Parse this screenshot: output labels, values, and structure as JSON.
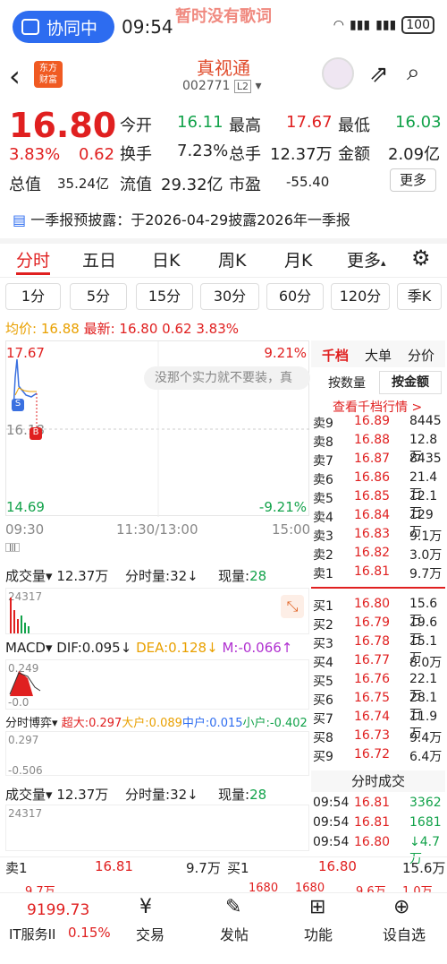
{
  "status": {
    "collab": "协同中",
    "time": "09:54",
    "lyric": "暂时没有歌词",
    "battery": "100"
  },
  "header": {
    "name": "真视通",
    "code": "002771",
    "level": "L2",
    "logo": "东方\n财富"
  },
  "quote": {
    "price": "16.80",
    "pct": "3.83%",
    "chg": "0.62",
    "open_l": "今开",
    "open": "16.11",
    "high_l": "最高",
    "high": "17.67",
    "low_l": "最低",
    "low": "16.03",
    "turn_l": "换手",
    "turn": "7.23%",
    "vol_l": "总手",
    "vol": "12.37万",
    "amt_l": "金额",
    "amt": "2.09亿",
    "mcap_l": "总值",
    "mcap": "35.24亿",
    "float_l": "流值",
    "float": "29.32亿",
    "pe_l": "市盈",
    "pe": "-55.40",
    "more": "更多"
  },
  "announcement": "一季报预披露：于2026-04-29披露2026年一季报",
  "tabs": [
    "分时",
    "五日",
    "日K",
    "周K",
    "月K",
    "更多"
  ],
  "periods": [
    "1分",
    "5分",
    "15分",
    "30分",
    "60分",
    "120分",
    "季K"
  ],
  "pricebar": {
    "avg_l": "均价:",
    "avg": "16.88",
    "last_l": "最新:",
    "last": "16.80",
    "chg": "0.62",
    "pct": "3.83%"
  },
  "chart": {
    "top": "17.67",
    "top_pct": "9.21%",
    "mid": "16.18",
    "bot": "14.69",
    "bot_pct": "-9.21%",
    "t1": "09:30",
    "t2": "11:30/13:00",
    "t3": "15:00",
    "toast": "没那个实力就不要装，真"
  },
  "vol1": {
    "label": "成交量",
    "value": "12.37万",
    "tl": "分时量:",
    "tv": "32↓",
    "cl": "现量:",
    "cv": "28",
    "max": "24317"
  },
  "macd": {
    "label": "MACD",
    "dif": "DIF:0.095↓",
    "dea": "DEA:0.128↓",
    "m": "M:-0.066↑",
    "top": "0.249",
    "bot": "-0.0"
  },
  "game": {
    "label": "分时博弈",
    "a": "超大:0.297",
    "b": "大户:0.089",
    "c": "中户:0.015",
    "d": "小户:-0.402",
    "top": "0.297",
    "bot": "-0.506"
  },
  "vol2": {
    "label": "成交量",
    "value": "12.37万",
    "tl": "分时量:",
    "tv": "32↓",
    "cl": "现量:",
    "cv": "28",
    "max": "24317"
  },
  "depth_tabs": [
    "千档",
    "大单",
    "分价"
  ],
  "depth_sub": [
    "按数量",
    "按金额"
  ],
  "depth_link": "查看千档行情 >",
  "asks": [
    [
      "卖9",
      "16.89",
      "8445"
    ],
    [
      "卖8",
      "16.88",
      "12.8万"
    ],
    [
      "卖7",
      "16.87",
      "8435"
    ],
    [
      "卖6",
      "16.86",
      "21.4万"
    ],
    [
      "卖5",
      "16.85",
      "12.1万"
    ],
    [
      "卖4",
      "16.84",
      "129万"
    ],
    [
      "卖3",
      "16.83",
      "9.1万"
    ],
    [
      "卖2",
      "16.82",
      "3.0万"
    ],
    [
      "卖1",
      "16.81",
      "9.7万"
    ]
  ],
  "bids": [
    [
      "买1",
      "16.80",
      "15.6万"
    ],
    [
      "买2",
      "16.79",
      "19.6万"
    ],
    [
      "买3",
      "16.78",
      "15.1万"
    ],
    [
      "买4",
      "16.77",
      "8.0万"
    ],
    [
      "买5",
      "16.76",
      "22.1万"
    ],
    [
      "买6",
      "16.75",
      "28.1万"
    ],
    [
      "买7",
      "16.74",
      "11.9万"
    ],
    [
      "买8",
      "16.73",
      "9.4万"
    ],
    [
      "买9",
      "16.72",
      "6.4万"
    ]
  ],
  "trades_title": "分时成交",
  "trades": [
    [
      "09:54",
      "16.81",
      "3362"
    ],
    [
      "09:54",
      "16.81",
      "1681"
    ],
    [
      "09:54",
      "16.80",
      "↓4.7万"
    ]
  ],
  "bottom_quote": {
    "s1": "卖1",
    "s1p": "16.81",
    "s1v": "9.7万",
    "b1": "买1",
    "b1p": "16.80",
    "b1v": "15.6万",
    "r2": "9.7万",
    "r2b": "1680",
    "r2c": "1680",
    "r2d": "9.6万",
    "r2e": "1.0万"
  },
  "bottom": {
    "index": "9199.73",
    "idx_name": "IT服务II",
    "idx_pct": "0.15%",
    "trade": "交易",
    "post": "发帖",
    "func": "功能",
    "alert": "设自选"
  }
}
